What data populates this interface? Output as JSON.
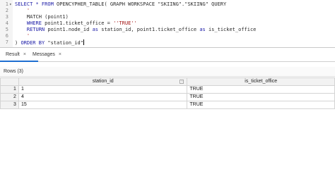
{
  "editor": {
    "lines": [
      {
        "no": "1",
        "fold": "▾",
        "parts": [
          {
            "t": "SELECT * FROM ",
            "c": "kw"
          },
          {
            "t": "OPENCYPHER_TABLE( GRAPH WORKSPACE \"SKIING\".\"SKIING\" QUERY",
            "c": ""
          }
        ]
      },
      {
        "no": "2",
        "fold": "",
        "parts": [
          {
            "t": "    '",
            "c": "str"
          }
        ]
      },
      {
        "no": "3",
        "fold": "",
        "parts": [
          {
            "t": "    MATCH (point1)",
            "c": ""
          }
        ]
      },
      {
        "no": "4",
        "fold": "",
        "parts": [
          {
            "t": "    WHERE ",
            "c": "kw"
          },
          {
            "t": "point1.ticket_office = ",
            "c": ""
          },
          {
            "t": "''TRUE''",
            "c": "str"
          }
        ]
      },
      {
        "no": "5",
        "fold": "",
        "parts": [
          {
            "t": "    RETURN ",
            "c": "kw"
          },
          {
            "t": "point1.node_id ",
            "c": ""
          },
          {
            "t": "as ",
            "c": "kw"
          },
          {
            "t": "station_id, point1.ticket_office ",
            "c": ""
          },
          {
            "t": "as ",
            "c": "kw"
          },
          {
            "t": "is_ticket_office",
            "c": ""
          }
        ]
      },
      {
        "no": "6",
        "fold": "",
        "parts": [
          {
            "t": "    '",
            "c": "str"
          }
        ]
      },
      {
        "no": "7",
        "fold": "",
        "parts": [
          {
            "t": ") ",
            "c": ""
          },
          {
            "t": "ORDER BY ",
            "c": "kw"
          },
          {
            "t": "\"station_id\"",
            "c": ""
          }
        ]
      }
    ]
  },
  "tabs": [
    {
      "label": "Result",
      "close": "×",
      "active": true
    },
    {
      "label": "Messages",
      "close": "×",
      "active": false
    }
  ],
  "results": {
    "rows_label": "Rows (3)",
    "columns": [
      "station_id",
      "is_ticket_office"
    ],
    "rows": [
      {
        "no": "1",
        "cells": [
          "1",
          "TRUE"
        ]
      },
      {
        "no": "2",
        "cells": [
          "4",
          "TRUE"
        ]
      },
      {
        "no": "3",
        "cells": [
          "15",
          "TRUE"
        ]
      }
    ],
    "sort_glyph": "↕"
  }
}
